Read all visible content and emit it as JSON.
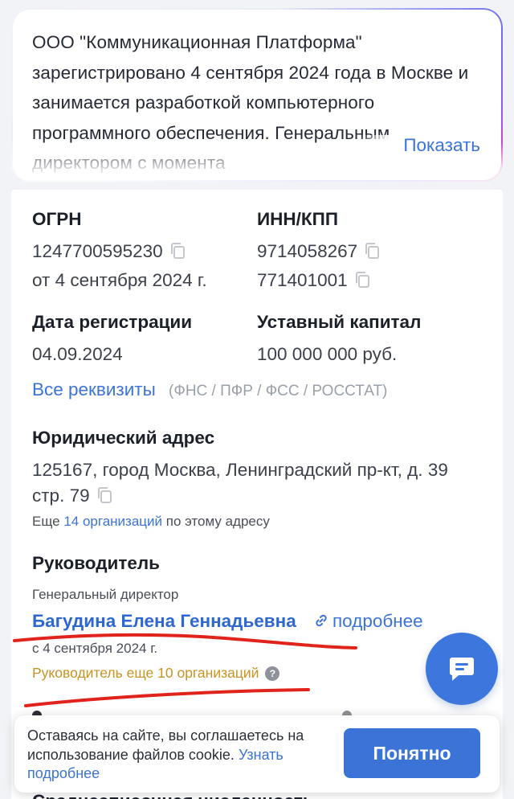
{
  "summary": {
    "text": "ООО \"Коммуникационная Платформа\" зарегистрировано 4 сентября 2024 года в Москве и занимается разработкой компьютерного программного обеспечения. Генеральным директором с момента",
    "show_more_label": "Показать"
  },
  "requisites": {
    "ogrn": {
      "label": "ОГРН",
      "value": "1247700595230",
      "date": "от 4 сентября 2024 г."
    },
    "inn_kpp": {
      "label": "ИНН/КПП",
      "inn": "9714058267",
      "kpp": "771401001"
    },
    "reg_date": {
      "label": "Дата регистрации",
      "value": "04.09.2024"
    },
    "capital": {
      "label": "Уставный капитал",
      "value": "100 000 000 руб."
    },
    "all_link": "Все реквизиты",
    "sources": "(ФНС / ПФР / ФСС / РОССТАТ)"
  },
  "address": {
    "label": "Юридический адрес",
    "line1": "125167, город Москва, Ленинградский пр-кт, д. 39",
    "line2": "стр. 79",
    "more_prefix": "Еще",
    "more_link": "14 организаций",
    "more_suffix": "по этому адресу"
  },
  "head": {
    "label": "Руководитель",
    "position": "Генеральный директор",
    "name": "Багудина Елена Геннадьевна",
    "details_link": "подробнее",
    "since": "с 4 сентября 2024 г.",
    "other_orgs": "Руководитель еще 10 организаций",
    "help_glyph": "?"
  },
  "cookie": {
    "text": "Оставаясь на сайте, вы соглашаетесь на использование файлов cookie.",
    "link": "Узнать подробнее",
    "button": "Понятно"
  },
  "cutoff_heading": "Среднесписочная численность",
  "colors": {
    "accent": "#3b73d6",
    "orange": "#c89322",
    "annotation_red": "#e0241c"
  }
}
